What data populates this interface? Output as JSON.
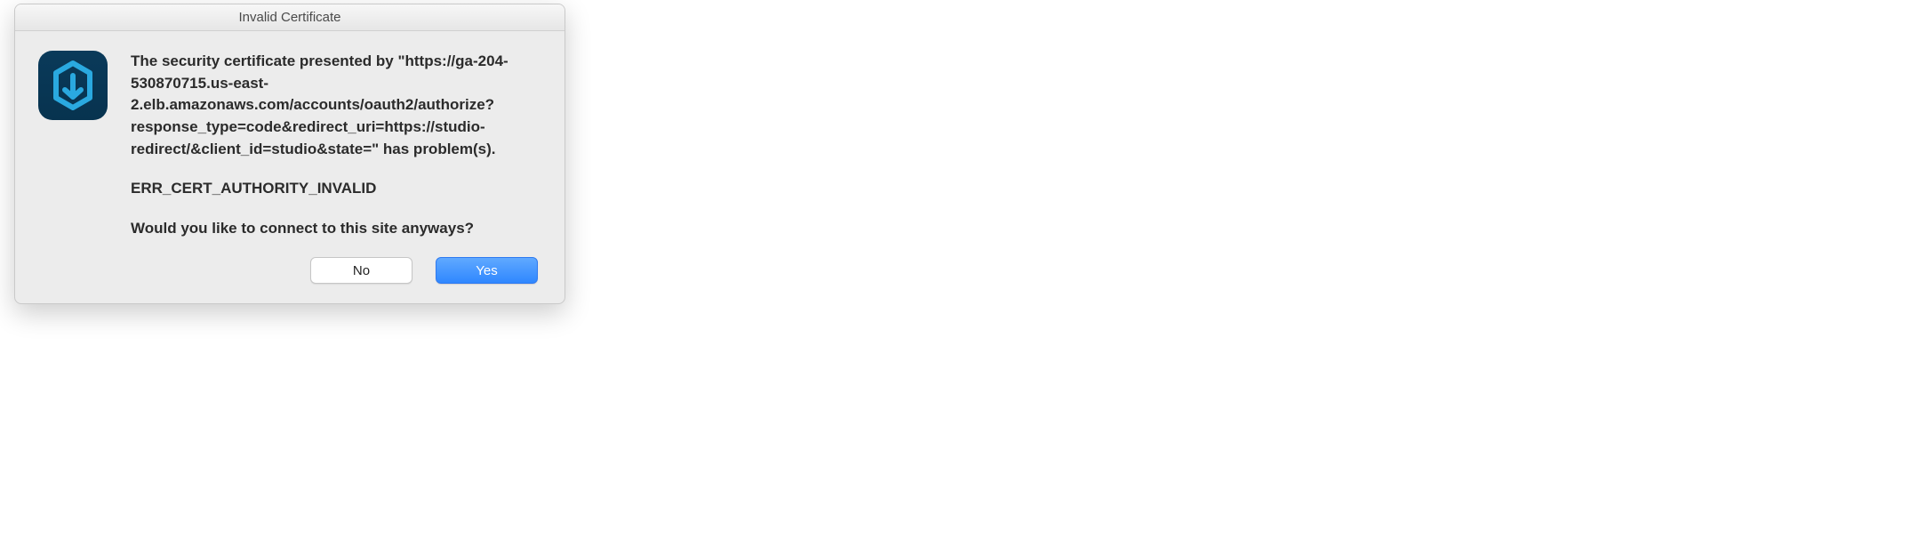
{
  "dialog": {
    "title": "Invalid Certificate",
    "icon_name": "app-icon",
    "paragraphs": {
      "p1": "The security certificate presented by \"https://ga-204-530870715.us-east-2.elb.amazonaws.com/accounts/oauth2/authorize?response_type=code&redirect_uri=https://studio-redirect/&client_id=studio&state=\" has problem(s).",
      "p2": "ERR_CERT_AUTHORITY_INVALID",
      "p3": "Would you like to connect to this site anyways?"
    },
    "buttons": {
      "no": "No",
      "yes": "Yes"
    }
  },
  "annotation": {
    "arrow_color": "#154b8e"
  }
}
